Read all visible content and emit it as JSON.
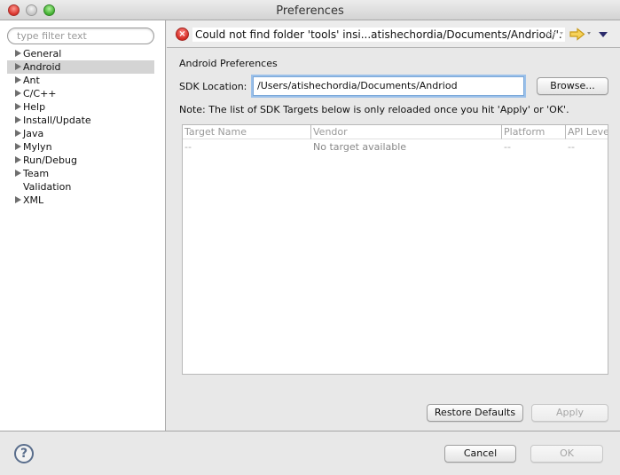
{
  "window": {
    "title": "Preferences"
  },
  "sidebar": {
    "filter_placeholder": "type filter text",
    "items": [
      {
        "label": "General",
        "expandable": true,
        "selected": false
      },
      {
        "label": "Android",
        "expandable": true,
        "selected": true
      },
      {
        "label": "Ant",
        "expandable": true,
        "selected": false
      },
      {
        "label": "C/C++",
        "expandable": true,
        "selected": false
      },
      {
        "label": "Help",
        "expandable": true,
        "selected": false
      },
      {
        "label": "Install/Update",
        "expandable": true,
        "selected": false
      },
      {
        "label": "Java",
        "expandable": true,
        "selected": false
      },
      {
        "label": "Mylyn",
        "expandable": true,
        "selected": false
      },
      {
        "label": "Run/Debug",
        "expandable": true,
        "selected": false
      },
      {
        "label": "Team",
        "expandable": true,
        "selected": false
      },
      {
        "label": "Validation",
        "expandable": false,
        "selected": false
      },
      {
        "label": "XML",
        "expandable": true,
        "selected": false
      }
    ]
  },
  "message_bar": {
    "error_text": "Could not find folder 'tools' insi...atishechordia/Documents/Andriod/'.",
    "icons": {
      "error": "error-circle-icon",
      "back": "back-arrow-icon",
      "forward": "forward-arrow-icon",
      "menu": "view-menu-icon"
    }
  },
  "main": {
    "section_title": "Android Preferences",
    "sdk_label": "SDK Location:",
    "sdk_value": "/Users/atishechordia/Documents/Andriod",
    "browse_label": "Browse...",
    "note": "Note: The list of SDK Targets below is only reloaded once you hit 'Apply' or 'OK'.",
    "table": {
      "columns": [
        "Target Name",
        "Vendor",
        "Platform",
        "API Leve"
      ],
      "rows": [
        [
          "--",
          "No target available",
          "--",
          "--"
        ]
      ]
    },
    "restore_defaults_label": "Restore Defaults",
    "apply_label": "Apply"
  },
  "footer": {
    "help_icon": "help-icon",
    "cancel_label": "Cancel",
    "ok_label": "OK"
  }
}
